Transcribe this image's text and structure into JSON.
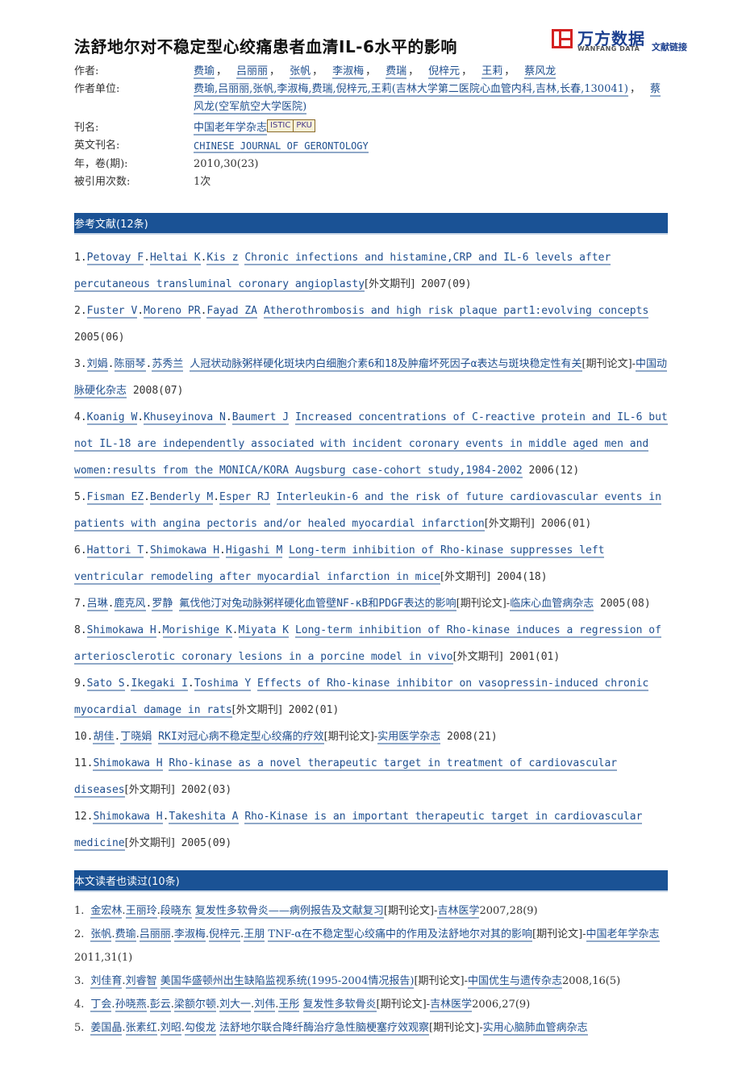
{
  "article": {
    "title": "法舒地尔对不稳定型心绞痛患者血清IL-6水平的影响",
    "logo": {
      "cn": "万方数据",
      "en": "WANFANG DATA",
      "link": "文献链接",
      "icon": "wanfang-logo-icon"
    },
    "meta": {
      "authors_label": "作者:",
      "authors": [
        "费瑜",
        "吕丽丽",
        "张帆",
        "李淑梅",
        "费瑞",
        "倪梓元",
        "王莉",
        "蔡风龙"
      ],
      "affiliation_label": "作者单位:",
      "affiliation_1": "费瑜,吕丽丽,张帆,李淑梅,费瑞,倪梓元,王莉(吉林大学第二医院心血管内科,吉林,长春,130041)",
      "affiliation_2": "蔡风龙(空军航空大学医院)",
      "journal_label": "刊名:",
      "journal": "中国老年学杂志",
      "badges": [
        "ISTIC",
        "PKU"
      ],
      "en_journal_label": "英文刊名:",
      "en_journal": "CHINESE JOURNAL OF GERONTOLOGY",
      "year_label": "年，卷(期):",
      "year_value": "2010,30(23)",
      "cited_label": "被引用次数:",
      "cited_value": "1次"
    }
  },
  "references": {
    "header": "参考文献(12条)",
    "items": [
      {
        "num": "1.",
        "authors": [
          "Petovay F",
          "Heltai K",
          "Kis z"
        ],
        "title": "Chronic infections and histamine,CRP and IL-6 levels after percutaneous transluminal coronary angioplasty",
        "type": "[外文期刊]",
        "source": "",
        "date": "2007(09)"
      },
      {
        "num": "2.",
        "authors": [
          "Fuster V",
          "Moreno PR",
          "Fayad ZA"
        ],
        "title": "Atherothrombosis and high risk plaque part1:evolving concepts",
        "type": "",
        "source": "",
        "date": "2005(06)"
      },
      {
        "num": "3.",
        "authors": [
          "刘娟",
          "陈丽琴",
          "苏秀兰"
        ],
        "title": "人冠状动脉粥样硬化斑块内白细胞介素6和18及肿瘤坏死因子α表达与斑块稳定性有关",
        "type": "[期刊论文]-",
        "source": "中国动脉硬化杂志",
        "date": "2008(07)"
      },
      {
        "num": "4.",
        "authors": [
          "Koanig W",
          "Khuseyinova N",
          "Baumert J"
        ],
        "title": "Increased concentrations of C-reactive protein and IL-6 but not IL-18 are independently associated with incident coronary events in middle aged men and women:results from the MONICA/KORA Augsburg case-cohort study,1984-2002",
        "type": "",
        "source": "",
        "date": "2006(12)"
      },
      {
        "num": "5.",
        "authors": [
          "Fisman EZ",
          "Benderly M",
          "Esper RJ"
        ],
        "title": "Interleukin-6 and the risk of future cardiovascular events in patients with angina pectoris and/or healed myocardial infarction",
        "type": "[外文期刊]",
        "source": "",
        "date": "2006(01)"
      },
      {
        "num": "6.",
        "authors": [
          "Hattori T",
          "Shimokawa H",
          "Higashi M"
        ],
        "title": "Long-term inhibition of Rho-kinase suppresses left ventricular remodeling after myocardial infarction in mice",
        "type": "[外文期刊]",
        "source": "",
        "date": "2004(18)"
      },
      {
        "num": "7.",
        "authors": [
          "吕琳",
          "鹿克风",
          "罗静"
        ],
        "title": "氟伐他汀对兔动脉粥样硬化血管壁NF-κB和PDGF表达的影响",
        "type": "[期刊论文]-",
        "source": "临床心血管病杂志",
        "date": "2005(08)"
      },
      {
        "num": "8.",
        "authors": [
          "Shimokawa H",
          "Morishige K",
          "Miyata K"
        ],
        "title": "Long-term inhibition of Rho-kinase induces a regression of arteriosclerotic coronary lesions in a porcine model in vivo",
        "type": "[外文期刊]",
        "source": "",
        "date": "2001(01)"
      },
      {
        "num": "9.",
        "authors": [
          "Sato S",
          "Ikegaki I",
          "Toshima Y"
        ],
        "title": "Effects of Rho-kinase inhibitor on vasopressin-induced chronic myocardial damage in rats",
        "type": "[外文期刊]",
        "source": "",
        "date": "2002(01)"
      },
      {
        "num": "10.",
        "authors": [
          "胡佳",
          "丁晓娟"
        ],
        "title": "RKI对冠心病不稳定型心绞痛的疗效",
        "type": "[期刊论文]-",
        "source": "实用医学杂志",
        "date": "2008(21)"
      },
      {
        "num": "11.",
        "authors": [
          "Shimokawa H"
        ],
        "title": "Rho-kinase as a novel therapeutic target in treatment of cardiovascular diseases",
        "type": "[外文期刊]",
        "source": "",
        "date": "2002(03)"
      },
      {
        "num": "12.",
        "authors": [
          "Shimokawa H",
          "Takeshita A"
        ],
        "title": "Rho-Kinase is an important therapeutic target in cardiovascular medicine",
        "type": "[外文期刊]",
        "source": "",
        "date": "2005(09)"
      }
    ]
  },
  "readers": {
    "header": "本文读者也读过(10条)",
    "items": [
      {
        "num": "1.",
        "authors": [
          "金宏林",
          "王丽玲",
          "段晓东"
        ],
        "title": "复发性多软骨炎——病例报告及文献复习",
        "type": "[期刊论文]-",
        "source": "吉林医学",
        "date": "2007,28(9)"
      },
      {
        "num": "2.",
        "authors": [
          "张帆",
          "费瑜",
          "吕丽丽",
          "李淑梅",
          "倪梓元",
          "王朋"
        ],
        "title": "TNF-α在不稳定型心绞痛中的作用及法舒地尔对其的影响",
        "type": "[期刊论文]-",
        "source": "中国老年学杂志",
        "date": "2011,31(1)"
      },
      {
        "num": "3.",
        "authors": [
          "刘佳育",
          "刘睿智"
        ],
        "title": "美国华盛顿州出生缺陷监视系统(1995-2004情况报告)",
        "type": "[期刊论文]-",
        "source": "中国优生与遗传杂志",
        "date": "2008,16(5)"
      },
      {
        "num": "4.",
        "authors": [
          "丁会",
          "孙晓燕",
          "彭云",
          "梁额尔顿",
          "刘大一",
          "刘伟",
          "王彤"
        ],
        "title": "复发性多软骨炎",
        "type": "[期刊论文]-",
        "source": "吉林医学",
        "date": "2006,27(9)"
      },
      {
        "num": "5.",
        "authors": [
          "姜国晶",
          "张素红",
          "刘昭",
          "勾俊龙"
        ],
        "title": "法舒地尔联合降纤酶治疗急性脑梗塞疗效观察",
        "type": "[期刊论文]-",
        "source": "实用心脑肺血管病杂志",
        "date": ""
      }
    ]
  }
}
